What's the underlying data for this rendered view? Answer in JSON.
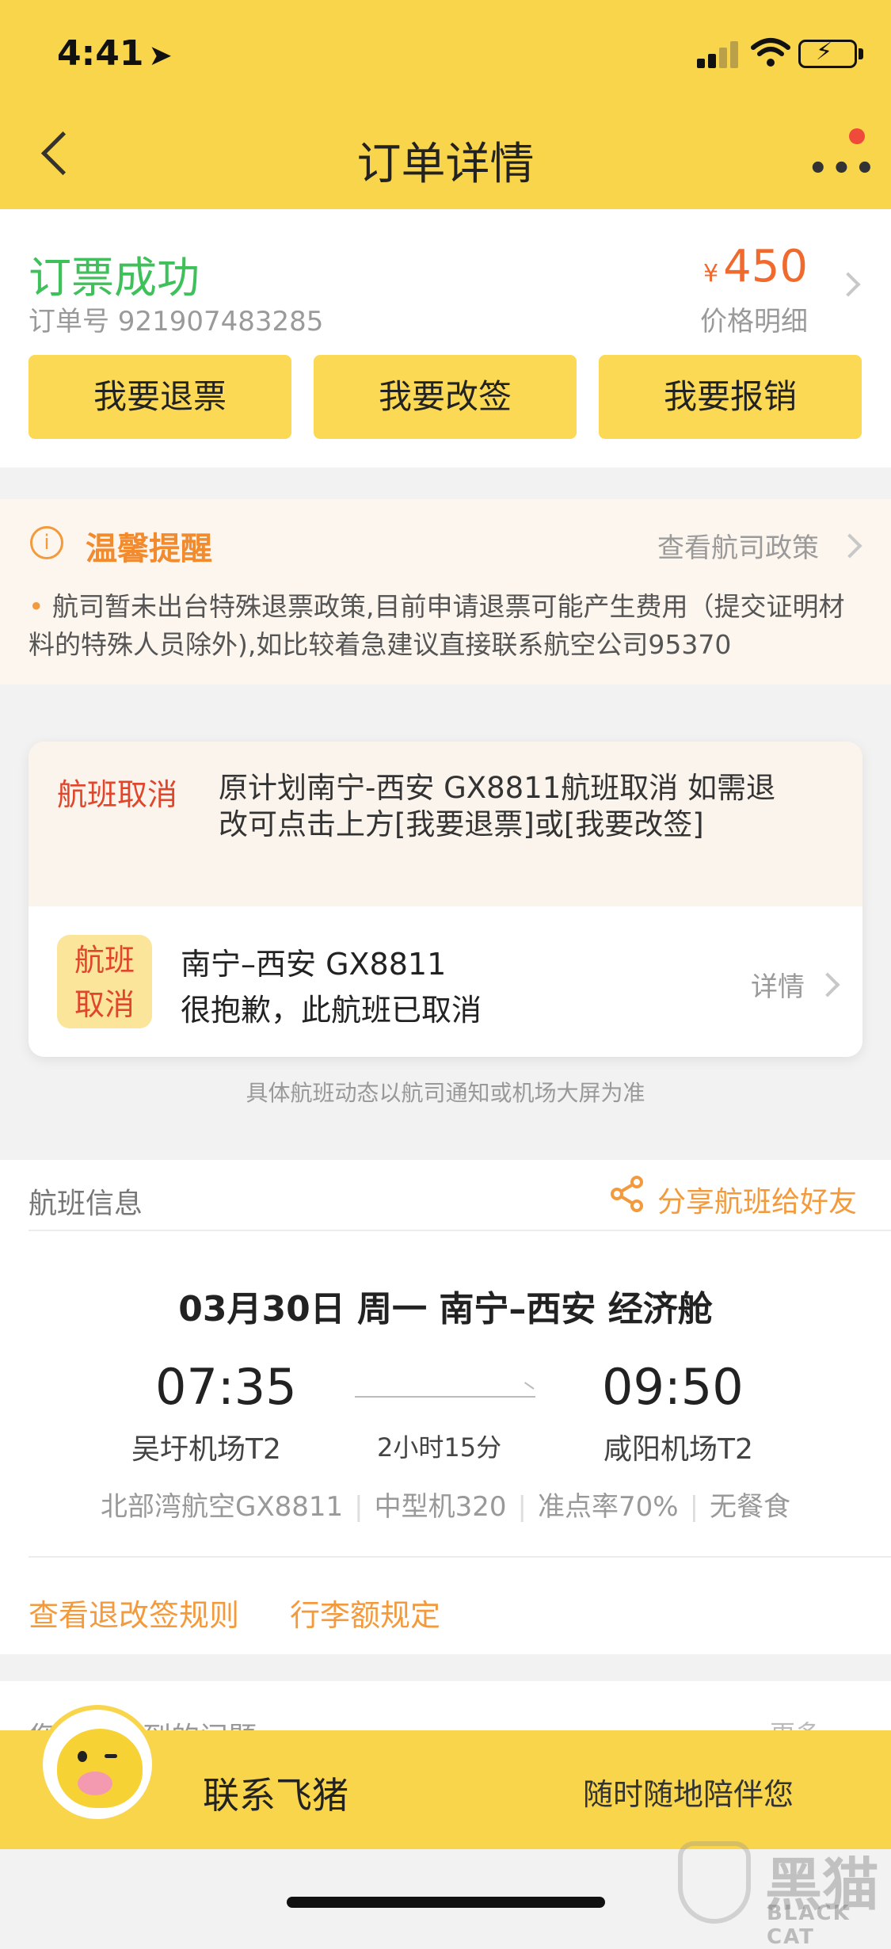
{
  "status_bar": {
    "time": "4:41"
  },
  "nav": {
    "title": "订单详情"
  },
  "order": {
    "status": "订票成功",
    "order_no": "订单号 921907483285",
    "currency": "¥",
    "price": "450",
    "price_detail": "价格明细",
    "actions": [
      "我要退票",
      "我要改签",
      "我要报销"
    ]
  },
  "reminder": {
    "title": "温馨提醒",
    "icon": "i",
    "link": "查看航司政策",
    "text": "航司暂未出台特殊退票政策,目前申请退票可能产生费用（提交证明材料的特殊人员除外),如比较着急建议直接联系航空公司95370"
  },
  "cancel": {
    "label": "航班取消",
    "message": "原计划南宁-西安 GX8811航班取消 如需退改可点击上方[我要退票]或[我要改签]",
    "badge_line1": "航班",
    "badge_line2": "取消",
    "route": "南宁–西安 GX8811",
    "note": "很抱歉，此航班已取消",
    "detail_link": "详情",
    "footnote": "具体航班动态以航司通知或机场大屏为准"
  },
  "flight_info": {
    "title": "航班信息",
    "share": "分享航班给好友",
    "summary": "03月30日 周一    南宁–西安    经济舱",
    "dep_time": "07:35",
    "arr_time": "09:50",
    "dep_airport": "吴圩机场T2",
    "arr_airport": "咸阳机场T2",
    "duration": "2小时15分",
    "meta": [
      "北部湾航空GX8811",
      "中型机320",
      "准点率70%",
      "无餐食"
    ],
    "rules_link": "查看退改签规则",
    "baggage_link": "行李额规定"
  },
  "questions": {
    "title": "您可能遇到的问题",
    "more": "更多"
  },
  "contact": {
    "title": "联系飞猪",
    "subtitle": "随时随地陪伴您"
  },
  "watermark": {
    "big": "黑猫",
    "small": "BLACK CAT"
  },
  "colors": {
    "brand_yellow": "#f9d54c",
    "success_green": "#3ec05a",
    "price_orange": "#f06a2e",
    "alert_red": "#e0462c",
    "link_orange": "#f39a3c"
  }
}
